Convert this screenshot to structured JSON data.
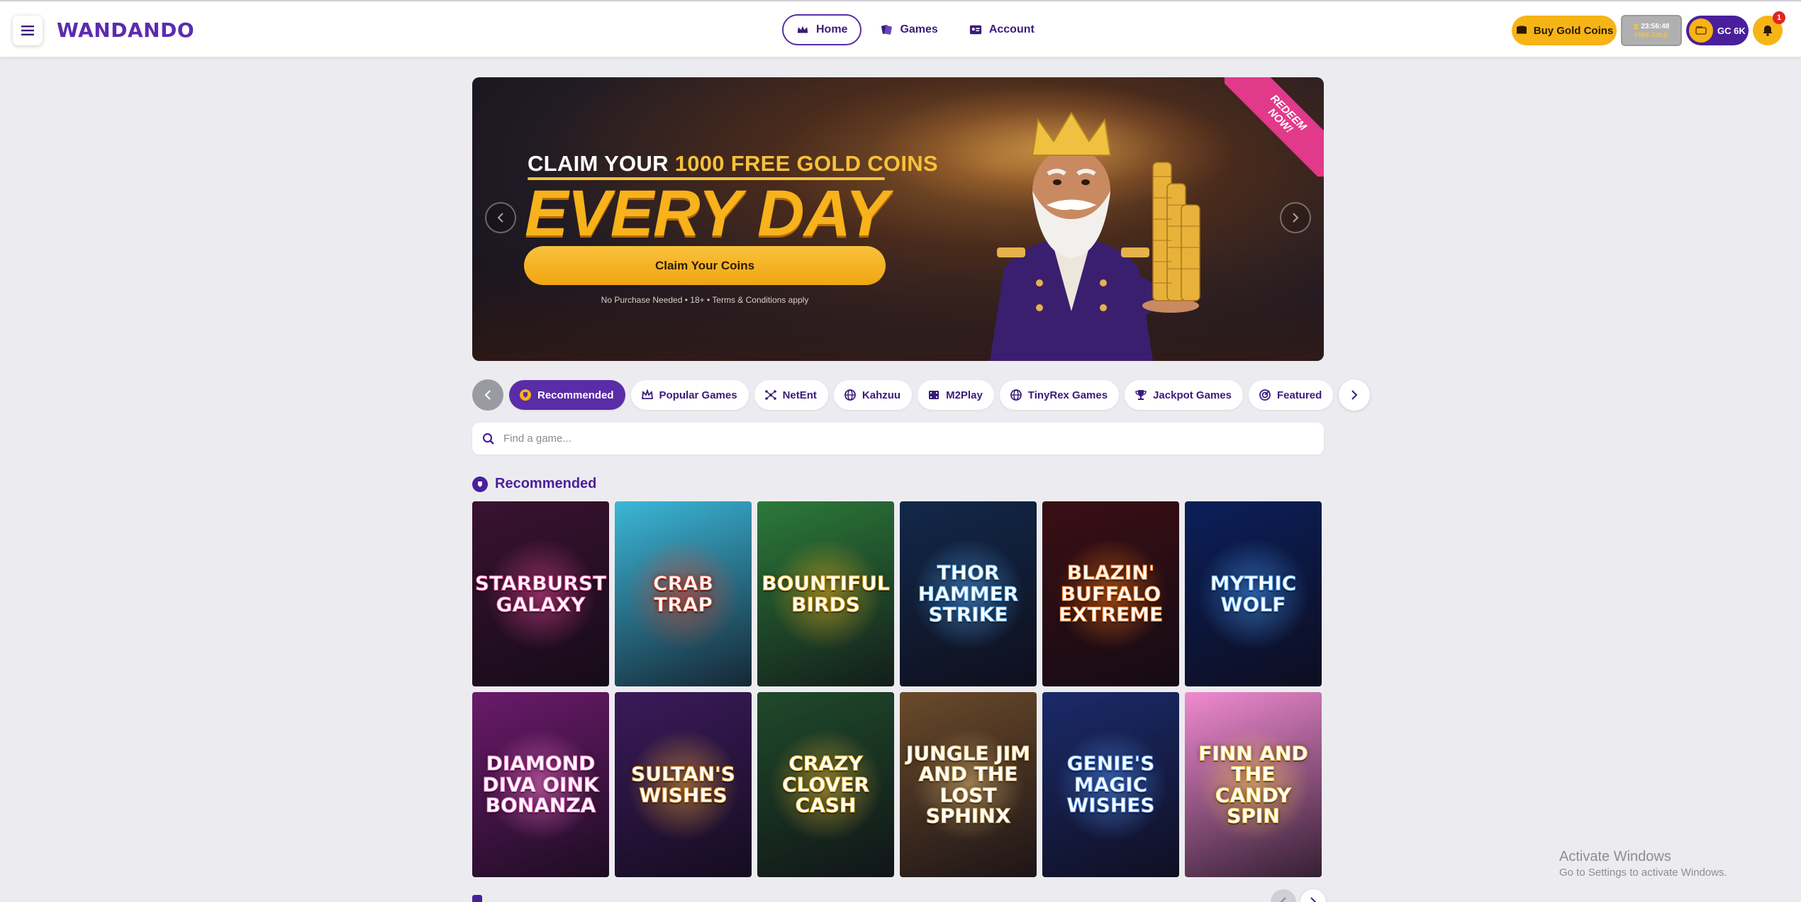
{
  "header": {
    "logo": "WANDANDO",
    "nav": [
      {
        "label": "Home",
        "icon": "crown-icon",
        "active": true
      },
      {
        "label": "Games",
        "icon": "games-icon",
        "active": false
      },
      {
        "label": "Account",
        "icon": "account-card-icon",
        "active": false
      }
    ],
    "buy_label": "Buy Gold Coins",
    "timer": {
      "time": "23:56:48",
      "sub": "FREE GOLD"
    },
    "balance": "GC 6K",
    "notifications_count": "1"
  },
  "hero": {
    "headline_prefix": "CLAIM YOUR ",
    "headline_highlight": "1000 FREE GOLD COINS",
    "headline_big": "EVERY DAY",
    "cta_label": "Claim Your Coins",
    "note": "No Purchase Needed • 18+ •  Terms & Conditions apply",
    "ribbon_line1": "REDEEM",
    "ribbon_line2": "NOW!"
  },
  "categories": [
    {
      "label": "Recommended",
      "icon": "badge-icon",
      "active": true
    },
    {
      "label": "Popular Games",
      "icon": "crown-outline-icon",
      "active": false
    },
    {
      "label": "NetEnt",
      "icon": "network-icon",
      "active": false
    },
    {
      "label": "Kahzuu",
      "icon": "globe-icon",
      "active": false
    },
    {
      "label": "M2Play",
      "icon": "film-icon",
      "active": false
    },
    {
      "label": "TinyRex Games",
      "icon": "globe-icon",
      "active": false
    },
    {
      "label": "Jackpot Games",
      "icon": "trophy-icon",
      "active": false
    },
    {
      "label": "Featured",
      "icon": "target-icon",
      "active": false
    }
  ],
  "search": {
    "placeholder": "Find a game..."
  },
  "section": {
    "title": "Recommended"
  },
  "games": [
    {
      "title": "Starburst Galaxy",
      "bg": "#3a1230",
      "accent": "#e84a9a"
    },
    {
      "title": "Crab Trap",
      "bg": "#3bb7d8",
      "accent": "#e8452a"
    },
    {
      "title": "Bountiful Birds",
      "bg": "#2c7a3a",
      "accent": "#f3b21c"
    },
    {
      "title": "Thor Hammer Strike",
      "bg": "#12284a",
      "accent": "#5ab0ff"
    },
    {
      "title": "Blazin' Buffalo Extreme",
      "bg": "#3a0f14",
      "accent": "#ff7a1a"
    },
    {
      "title": "Mythic Wolf",
      "bg": "#0b1f5a",
      "accent": "#4aa0ff"
    },
    {
      "title": "Diamond Diva Oink Bonanza",
      "bg": "#6a1a6a",
      "accent": "#ff7ad0"
    },
    {
      "title": "Sultan's Wishes",
      "bg": "#3a1a5a",
      "accent": "#f3a83a"
    },
    {
      "title": "Crazy Clover Cash",
      "bg": "#1f4a2a",
      "accent": "#f5c23a"
    },
    {
      "title": "Jungle Jim and the Lost Sphinx",
      "bg": "#6a4a2a",
      "accent": "#e8c27a"
    },
    {
      "title": "Genie's Magic Wishes",
      "bg": "#1a2a6a",
      "accent": "#5a9aff"
    },
    {
      "title": "Finn and the Candy Spin",
      "bg": "#f08ad0",
      "accent": "#ffd24a"
    }
  ],
  "watermark": {
    "line1": "Activate Windows",
    "line2": "Go to Settings to activate Windows."
  }
}
